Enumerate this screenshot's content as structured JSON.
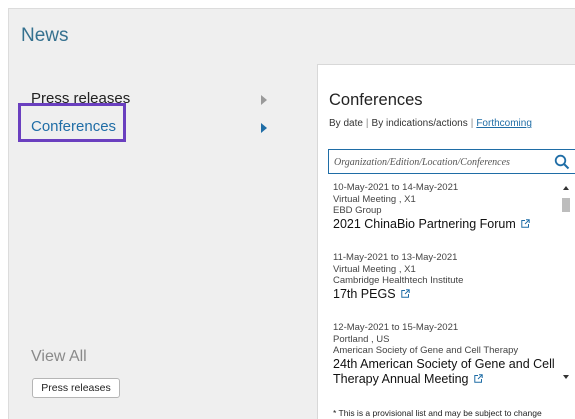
{
  "header": {
    "title": "News"
  },
  "nav": {
    "items": [
      {
        "label": "Press releases"
      },
      {
        "label": "Conferences"
      }
    ]
  },
  "view_all": {
    "label": "View All",
    "button_label": "Press releases"
  },
  "panel": {
    "title": "Conferences",
    "filters": {
      "by_date": "By date",
      "separator": "|",
      "by_indications": "By indications/actions",
      "forthcoming": "Forthcoming"
    },
    "search": {
      "placeholder": "Organization/Edition/Location/Conferences"
    },
    "events": [
      {
        "dates": "10-May-2021 to 14-May-2021",
        "location": "Virtual Meeting , X1",
        "organizer": "EBD Group",
        "name": "2021 ChinaBio Partnering Forum"
      },
      {
        "dates": "11-May-2021 to 13-May-2021",
        "location": "Virtual Meeting , X1",
        "organizer": "Cambridge Healthtech Institute",
        "name": "17th PEGS"
      },
      {
        "dates": "12-May-2021 to 15-May-2021",
        "location": "Portland , US",
        "organizer": "American Society of Gene and Cell Therapy",
        "name_line1": "24th American Society of Gene and Cell",
        "name_line2": "Therapy Annual Meeting"
      }
    ],
    "disclaimer": "* This is a provisional list and may be subject to change"
  },
  "colors": {
    "accent": "#1f6da6",
    "highlight_box": "#6a3fbf",
    "panel_bg": "#ffffff",
    "page_bg": "#efefef"
  }
}
